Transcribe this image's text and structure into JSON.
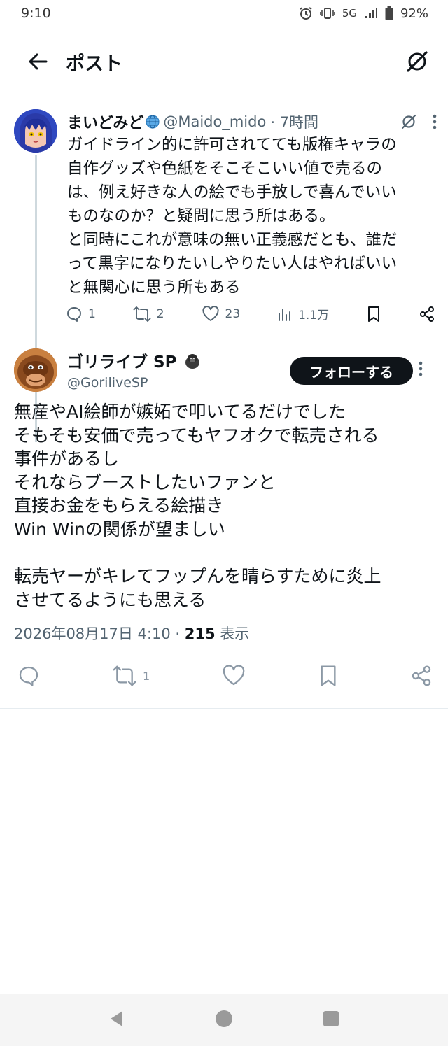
{
  "status_bar": {
    "time": "9:10",
    "network": "5G",
    "battery": "92%"
  },
  "header": {
    "title": "ポスト"
  },
  "parent_post": {
    "display_name": "まいどみど",
    "handle": "@Maido_mido",
    "time": "· 7時間",
    "text_lines": [
      "ガイドライン的に許可されてても版権キャラの",
      "自作グッズや色紙をそこそこいい値で売るの",
      "は、例え好きな人の絵でも手放しで喜んでいい",
      "ものなのか？と疑問に思う所はある。",
      "と同時にこれが意味の無い正義感だとも、誰だ",
      "って黒字になりたいしやりたい人はやればいい",
      "と無関心に思う所もある"
    ],
    "stats": {
      "replies": "1",
      "reposts": "2",
      "likes": "23",
      "views": "1.1万"
    }
  },
  "main_post": {
    "display_name": "ゴリライブ SP",
    "handle": "@GoriliveSP",
    "follow_label": "フォローする",
    "text": "無産やAI絵師が嫉妬で叩いてるだけでした\nそもそも安価で売ってもヤフオクで転売される\n事件があるし\nそれならブーストしたいファンと\n直接お金をもらえる絵描き\nWin Winの関係が望ましい\n\n転売ヤーがキレてフップんを晴らすために炎上\nさせてるようにも思える",
    "date": "2026年08月17日 4:10",
    "views_count": "215",
    "views_label": "表示",
    "repost_count": "1"
  },
  "colors": {
    "text": "#0f1419",
    "secondary": "#536471",
    "line": "#cfd9de"
  }
}
